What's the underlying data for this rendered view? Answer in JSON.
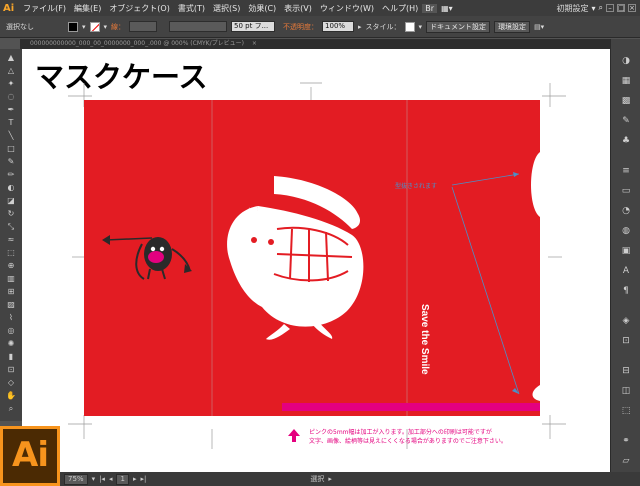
{
  "app": {
    "logo": "Ai",
    "workspace_label": "初期設定"
  },
  "menu": [
    "ファイル(F)",
    "編集(E)",
    "オブジェクト(O)",
    "書式(T)",
    "選択(S)",
    "効果(C)",
    "表示(V)",
    "ウィンドウ(W)",
    "ヘルプ(H)"
  ],
  "control_bar": {
    "selection_label": "選択なし",
    "stroke_label": "線：",
    "brush_value": "50 pt フ...",
    "opacity_label": "不透明度：",
    "opacity_value": "100%",
    "style_label": "スタイル：",
    "doc_settings_button": "ドキュメント設定",
    "preferences_button": "環境設定",
    "colors": {
      "fill": "#000000",
      "stroke_none": "#ffffff"
    }
  },
  "document_tab": "000000000000_000_00_0000000_000_.000 @ 000% (CMYK/プレビュー)",
  "artboard": {
    "title": "マスクケース",
    "vertical_text": "Save the Smile",
    "cut_note": "型抜きされます",
    "footnote_line1": "ピンクの5mm幅は加工が入ります。加工部分への印刷は可能ですが",
    "footnote_line2": "文字、画像、絵柄等は見えにくくなる場合がありますのでご注意下さい。",
    "colors": {
      "background": "#e31c23",
      "pink_band": "#e4007f",
      "note_blue": "#4a90c8",
      "note_pink": "#e4007f"
    }
  },
  "status": {
    "zoom": "75%",
    "page": "1",
    "selection_tool": "選択"
  },
  "badge": {
    "label": "Ai",
    "accent": "#f7941d"
  }
}
